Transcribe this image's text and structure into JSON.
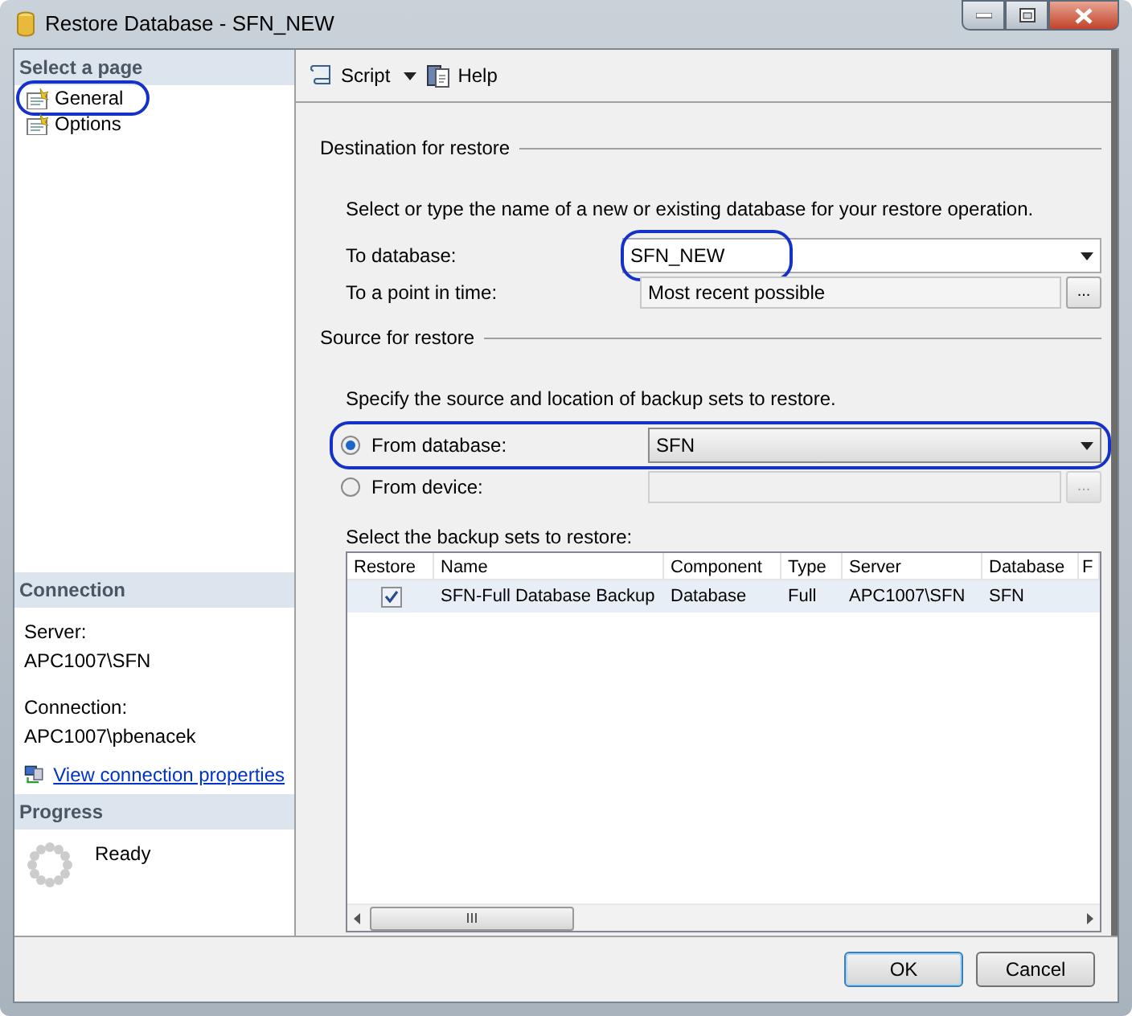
{
  "window": {
    "title": "Restore Database - SFN_NEW"
  },
  "sidebar": {
    "header": "Select a page",
    "pages": [
      {
        "label": "General",
        "annotated": true
      },
      {
        "label": "Options",
        "annotated": false
      }
    ]
  },
  "connection": {
    "header": "Connection",
    "server_label": "Server:",
    "server": "APC1007\\SFN",
    "connection_label": "Connection:",
    "connection": "APC1007\\pbenacek",
    "link": "View connection properties"
  },
  "progress": {
    "header": "Progress",
    "status": "Ready"
  },
  "toolbar": [
    {
      "label": "Script",
      "kind": "dropdown"
    },
    {
      "label": "Help",
      "kind": "button"
    }
  ],
  "destination": {
    "legend": "Destination for restore",
    "description": "Select or type the name of a new or existing database for your restore operation.",
    "to_database": {
      "label": "To database:",
      "value": "SFN_NEW",
      "annotated": true
    },
    "point_in_time": {
      "label": "To a point in time:",
      "value": "Most recent possible",
      "button": "..."
    }
  },
  "source": {
    "legend": "Source for restore",
    "description": "Specify the source and location of backup sets to restore.",
    "options": [
      {
        "label": "From database:",
        "selected": true,
        "kind": "dropdown",
        "value": "SFN",
        "annotated": true
      },
      {
        "label": "From device:",
        "selected": false,
        "kind": "browse",
        "button": "...",
        "annotated": false
      }
    ]
  },
  "backup_sets": {
    "label": "Select the backup sets to restore:",
    "columns": [
      "Restore",
      "Name",
      "Component",
      "Type",
      "Server",
      "Database",
      "F"
    ],
    "rows": [
      {
        "checked": true,
        "selected": true,
        "cells": [
          "",
          "SFN-Full Database Backup",
          "Database",
          "Full",
          "APC1007\\SFN",
          "SFN"
        ]
      }
    ]
  },
  "buttons": [
    {
      "label": "OK",
      "default": true
    },
    {
      "label": "Cancel",
      "default": false
    }
  ]
}
